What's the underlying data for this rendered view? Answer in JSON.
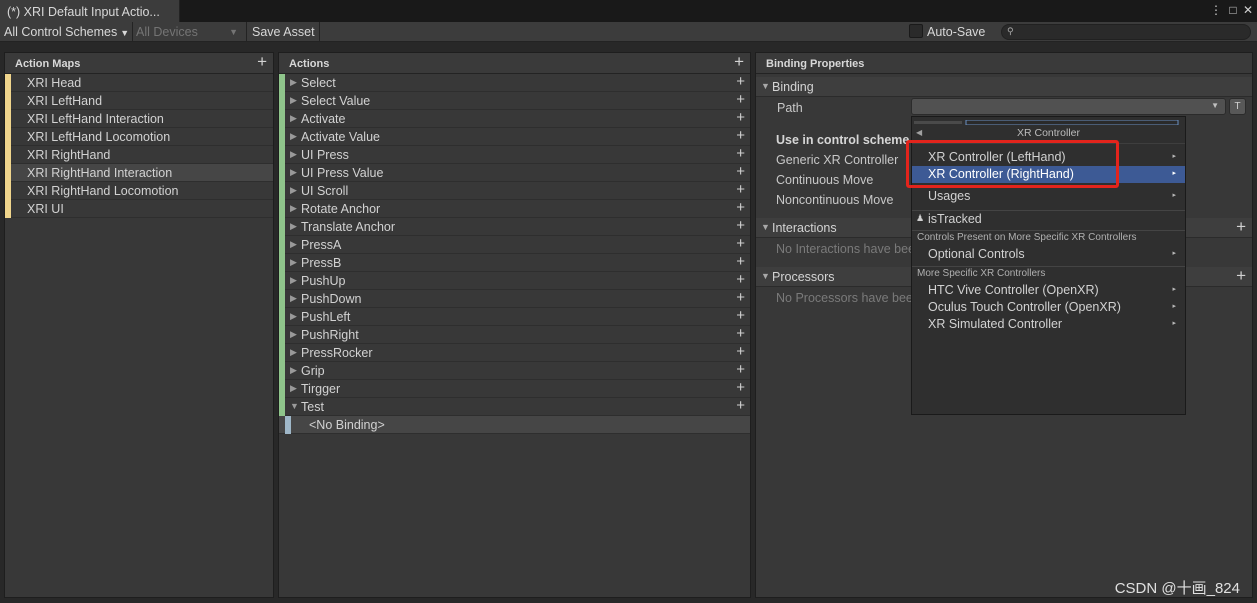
{
  "window": {
    "tab_title": "(*) XRI Default Input Actio...",
    "menu_icon": "kebab-menu",
    "maximize_icon": "maximize",
    "close_icon": "close"
  },
  "toolbar": {
    "control_schemes": "All Control Schemes",
    "devices": "All Devices",
    "save_asset": "Save Asset",
    "auto_save_label": "Auto-Save",
    "search_icon": "search",
    "search_value": ""
  },
  "action_maps": {
    "header": "Action Maps",
    "color": "#f0d58c",
    "items": [
      "XRI Head",
      "XRI LeftHand",
      "XRI LeftHand Interaction",
      "XRI LeftHand Locomotion",
      "XRI RightHand",
      "XRI RightHand Interaction",
      "XRI RightHand Locomotion",
      "XRI UI"
    ],
    "selected": "XRI RightHand Interaction"
  },
  "actions": {
    "header": "Actions",
    "color": "#8fc58b",
    "items": [
      "Select",
      "Select Value",
      "Activate",
      "Activate Value",
      "UI Press",
      "UI Press Value",
      "UI Scroll",
      "Rotate Anchor",
      "Translate Anchor",
      "PressA",
      "PressB",
      "PushUp",
      "PushDown",
      "PushLeft",
      "PushRight",
      "PressRocker",
      "Grip",
      "Tirgger",
      "Test"
    ],
    "expanded": "Test",
    "binding_child": "<No Binding>"
  },
  "binding_properties": {
    "header": "Binding Properties",
    "binding_section": "Binding",
    "path_label": "Path",
    "path_value": "",
    "t_button": "T",
    "control_scheme_title": "Use in control scheme",
    "schemes": [
      "Generic XR Controller",
      "Continuous Move",
      "Noncontinuous Move"
    ],
    "interactions_section": "Interactions",
    "interactions_empty": "No Interactions have bee",
    "processors_section": "Processors",
    "processors_empty": "No Processors have bee"
  },
  "dropdown": {
    "header": "XR Controller",
    "back_icon": "triangle-left",
    "items_top": [
      {
        "label": "XR Controller (LeftHand)",
        "submenu": true
      },
      {
        "label": "XR Controller (RightHand)",
        "submenu": true,
        "selected": true
      },
      {
        "label": "Usages",
        "submenu": true
      }
    ],
    "is_tracked": "isTracked",
    "is_tracked_icon": "person",
    "group1_label": "Controls Present on More Specific XR Controllers",
    "group1_items": [
      {
        "label": "Optional Controls",
        "submenu": true
      }
    ],
    "group2_label": "More Specific XR Controllers",
    "group2_items": [
      {
        "label": "HTC Vive Controller (OpenXR)",
        "submenu": true
      },
      {
        "label": "Oculus Touch Controller (OpenXR)",
        "submenu": true
      },
      {
        "label": "XR Simulated Controller",
        "submenu": true
      }
    ],
    "selected_color": "#3d5a95",
    "highlight_color": "#e3241c"
  },
  "watermark": "CSDN @十画_824"
}
